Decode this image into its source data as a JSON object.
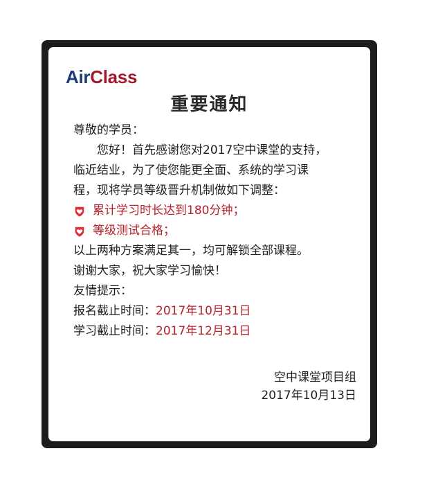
{
  "logo": {
    "part1": "Air",
    "part2": "Class"
  },
  "title": "重要通知",
  "greeting": "尊敬的学员：",
  "paragraph_lines": [
    "您好！首先感谢您对2017空中课堂的支持，",
    "临近结业，为了使您能更全面、系统的学习课",
    "程，现将学员等级晋升机制做如下调整："
  ],
  "conditions": [
    {
      "icon": "heart-shield-icon",
      "text": "累计学习时长达到180分钟；"
    },
    {
      "icon": "heart-shield-icon",
      "text": "等级测试合格；"
    }
  ],
  "after_lines": [
    "以上两种方案满足其一，均可解锁全部课程。",
    "谢谢大家，祝大家学习愉快！",
    "友情提示："
  ],
  "deadlines": [
    {
      "label": "报名截止时间：",
      "date": "2017年10月31日"
    },
    {
      "label": "学习截止时间：",
      "date": "2017年12月31日"
    }
  ],
  "signature": {
    "org": "空中课堂项目组",
    "date": "2017年10月13日"
  },
  "colors": {
    "accent_red": "#b5202a",
    "brand_blue": "#1f3c7a",
    "brand_red": "#a01c2c",
    "frame": "#1c1c1c"
  }
}
